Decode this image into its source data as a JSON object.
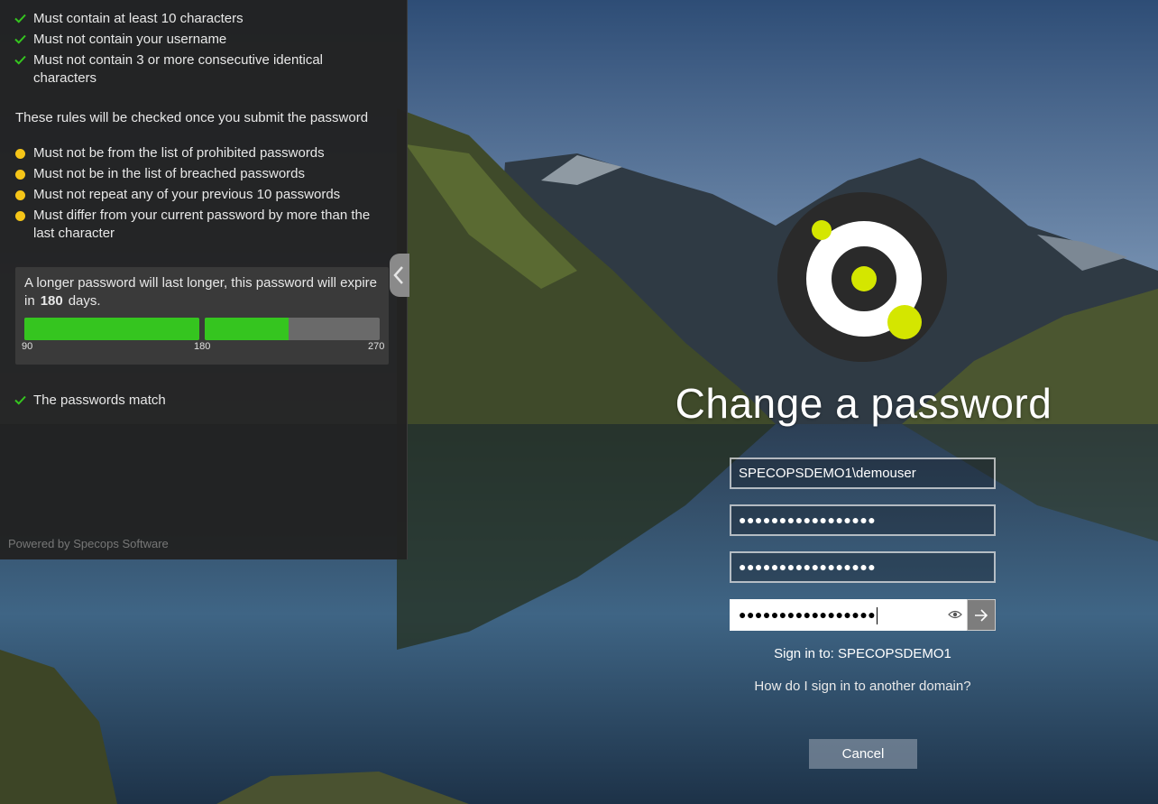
{
  "policy": {
    "met_rules": [
      "Must contain at least 10 characters",
      "Must not contain your username",
      "Must not contain 3 or more consecutive identical characters"
    ],
    "later_heading": "These rules will be checked once you submit the password",
    "pending_rules": [
      "Must not be from the list of prohibited passwords",
      "Must not be in the list of breached passwords",
      "Must not repeat any of your previous 10 passwords",
      "Must differ from your current password by more than the last character"
    ],
    "expiry": {
      "text_before": "A longer password will last longer, this password will expire in",
      "days": "180",
      "text_after": "days.",
      "ticks": [
        "90",
        "180",
        "270"
      ],
      "progress_fraction": 0.74
    },
    "match_message": "The passwords match",
    "powered_by": "Powered by Specops Software"
  },
  "form": {
    "title": "Change a password",
    "username": "SPECOPSDEMO1\\demouser",
    "old_password_mask": "●●●●●●●●●●●●●●●●●",
    "new_password_mask": "●●●●●●●●●●●●●●●●●",
    "confirm_password_mask": "●●●●●●●●●●●●●●●●●",
    "sign_in_to": "Sign in to: SPECOPSDEMO1",
    "other_domain_link": "How do I sign in to another domain?",
    "cancel_label": "Cancel"
  },
  "colors": {
    "ok_green": "#35c51f",
    "pending_yellow": "#f5c518",
    "logo_accent": "#d4e600"
  }
}
